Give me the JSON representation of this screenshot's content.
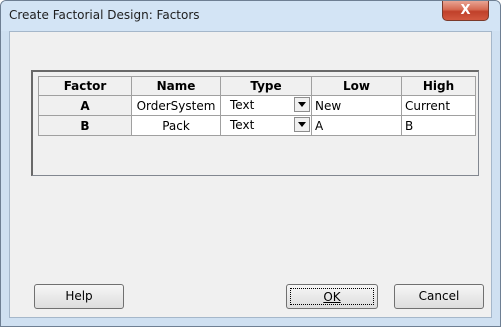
{
  "window": {
    "title": "Create Factorial Design: Factors",
    "close_glyph": "X"
  },
  "table": {
    "headers": [
      "Factor",
      "Name",
      "Type",
      "Low",
      "High"
    ],
    "rows": [
      {
        "factor": "A",
        "name": "OrderSystem",
        "type": "Text",
        "low": "New",
        "high": "Current"
      },
      {
        "factor": "B",
        "name": "Pack",
        "type": "Text",
        "low": "A",
        "high": "B"
      }
    ]
  },
  "buttons": {
    "help": "Help",
    "ok": "OK",
    "cancel": "Cancel"
  },
  "colors": {
    "titlebar": "#d3e4f5",
    "close_button": "#c0402a",
    "dialog_background": "#f0f0f0"
  }
}
